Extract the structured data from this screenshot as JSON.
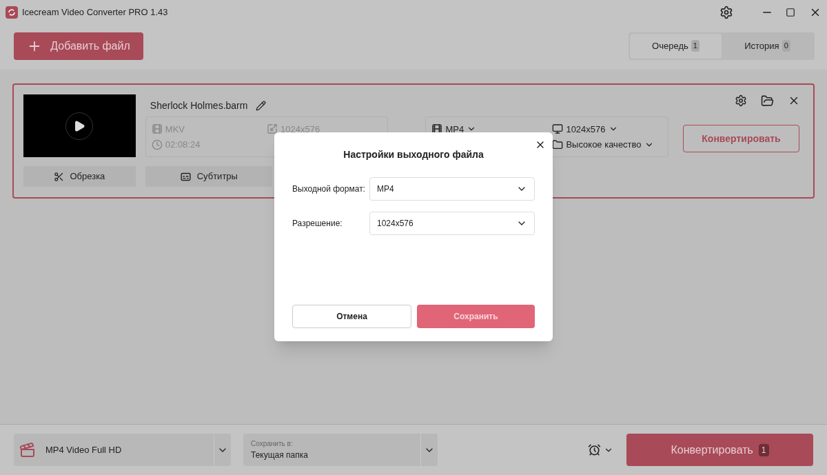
{
  "window": {
    "title": "Icecream Video Converter PRO 1.43"
  },
  "add_button": "Добавить файл",
  "tabs": [
    {
      "label": "Очередь",
      "count": "1",
      "selected": true
    },
    {
      "label": "История",
      "count": "0",
      "selected": false
    }
  ],
  "file_card": {
    "name": "Sherlock Holmes.barm",
    "source": {
      "format": "MKV",
      "resolution": "1024x576",
      "duration": "02:08:24"
    },
    "output": {
      "format": "MP4",
      "resolution": "1024x576",
      "quality": "Высокое качество"
    },
    "actions": [
      "Обрезка",
      "Субтитры"
    ],
    "convert": "Конвертировать"
  },
  "dialog": {
    "title": "Настройки выходного файла",
    "fields": [
      {
        "label": "Выходной формат:",
        "value": "MP4"
      },
      {
        "label": "Разрешение:",
        "value": "1024x576"
      }
    ],
    "cancel": "Отмена",
    "save": "Сохранить"
  },
  "bottom_bar": {
    "preset": "MP4 Video Full HD",
    "save_label": "Сохранить в:",
    "save_value": "Текущая папка",
    "convert": "Конвертировать",
    "convert_count": "1"
  }
}
